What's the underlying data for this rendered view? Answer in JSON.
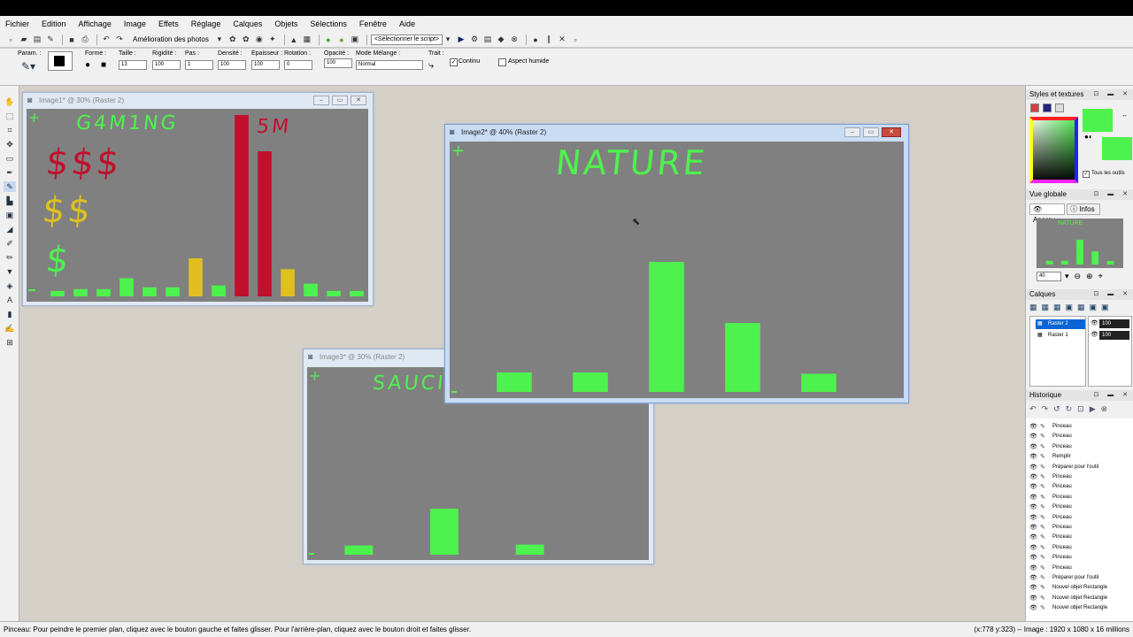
{
  "menu": [
    "Fichier",
    "Edition",
    "Affichage",
    "Image",
    "Effets",
    "Réglage",
    "Calques",
    "Objets",
    "Sélections",
    "Fenêtre",
    "Aide"
  ],
  "toolbar": {
    "photo_enhance": "Amélioration des photos",
    "script_select": "<Sélectionner le script>"
  },
  "options": {
    "param_label": "Param. :",
    "forme_label": "Forme :",
    "taille_label": "Taille :",
    "taille_value": "13",
    "rigidite_label": "Rigidité :",
    "rigidite_value": "100",
    "pas_label": "Pas :",
    "pas_value": "1",
    "densite_label": "Densité :",
    "densite_value": "100",
    "epaisseur_label": "Epaisseur :",
    "epaisseur_value": "100",
    "rotation_label": "Rotation :",
    "rotation_value": "0",
    "opacite_label": "Opacité :",
    "opacite_value": "100",
    "mode_label": "Mode Mélange :",
    "mode_value": "Normal",
    "trait_label": "Trait :",
    "continu_label": "Continu",
    "continu_checked": true,
    "humide_label": "Aspect humide",
    "humide_checked": false
  },
  "windows": {
    "image1": {
      "title": "Image1* @  30% (Raster 2)",
      "heading": "G4M1NG",
      "row1": "$$$",
      "row2": "$$",
      "row3": "$",
      "label": "5M",
      "bars": [
        {
          "value": 3,
          "color": "#4ef24e"
        },
        {
          "value": 4,
          "color": "#4ef24e"
        },
        {
          "value": 4,
          "color": "#4ef24e"
        },
        {
          "value": 10,
          "color": "#4ef24e"
        },
        {
          "value": 5,
          "color": "#4ef24e"
        },
        {
          "value": 5,
          "color": "#4ef24e"
        },
        {
          "value": 21,
          "color": "#e0c020"
        },
        {
          "value": 6,
          "color": "#4ef24e"
        },
        {
          "value": 100,
          "color": "#c0102c"
        },
        {
          "value": 80,
          "color": "#c0102c"
        },
        {
          "value": 15,
          "color": "#e0c020"
        },
        {
          "value": 7,
          "color": "#4ef24e"
        },
        {
          "value": 3,
          "color": "#4ef24e"
        },
        {
          "value": 3,
          "color": "#4ef24e"
        }
      ]
    },
    "image2": {
      "title": "Image2* @  40% (Raster 2)",
      "heading": "NATURE",
      "bars": [
        15,
        15,
        100,
        53,
        14
      ]
    },
    "image3": {
      "title": "Image3* @  30% (Raster 2)",
      "heading": "SAUCI",
      "bars": [
        20,
        100,
        22
      ]
    }
  },
  "panels": {
    "styles_title": "Styles et textures",
    "tous_outils": "Tous les outils",
    "vue_title": "Vue globale",
    "apercu_tab": "Aperçu",
    "infos_tab": "Infos",
    "zoom_value": "40",
    "calques_title": "Calques",
    "layers": [
      {
        "name": "Raster 2",
        "opacity": "100",
        "selected": true
      },
      {
        "name": "Raster 1",
        "opacity": "100",
        "selected": false
      }
    ],
    "historique_title": "Historique",
    "history": [
      "Pinceau",
      "Pinceau",
      "Pinceau",
      "Remplir",
      "Préparer pour l'outil",
      "Pinceau",
      "Pinceau",
      "Pinceau",
      "Pinceau",
      "Pinceau",
      "Pinceau",
      "Pinceau",
      "Pinceau",
      "Pinceau",
      "Pinceau",
      "Préparer pour l'outil",
      "Nouvel objet Rectangle",
      "Nouvel objet Rectangle",
      "Nouvel objet Rectangle"
    ]
  },
  "status": {
    "left": "Pinceau: Pour peindre le premier plan, cliquez avec le bouton gauche et faites glisser. Pour l'arrière-plan, cliquez avec le bouton droit et faites glisser.",
    "right": "(x:778 y:323) -- Image : 1920 x 1080 x 16 millions"
  },
  "colors": {
    "green": "#4ef24e",
    "red": "#c0102c",
    "yellow": "#e0c020",
    "canvas": "#808080"
  }
}
